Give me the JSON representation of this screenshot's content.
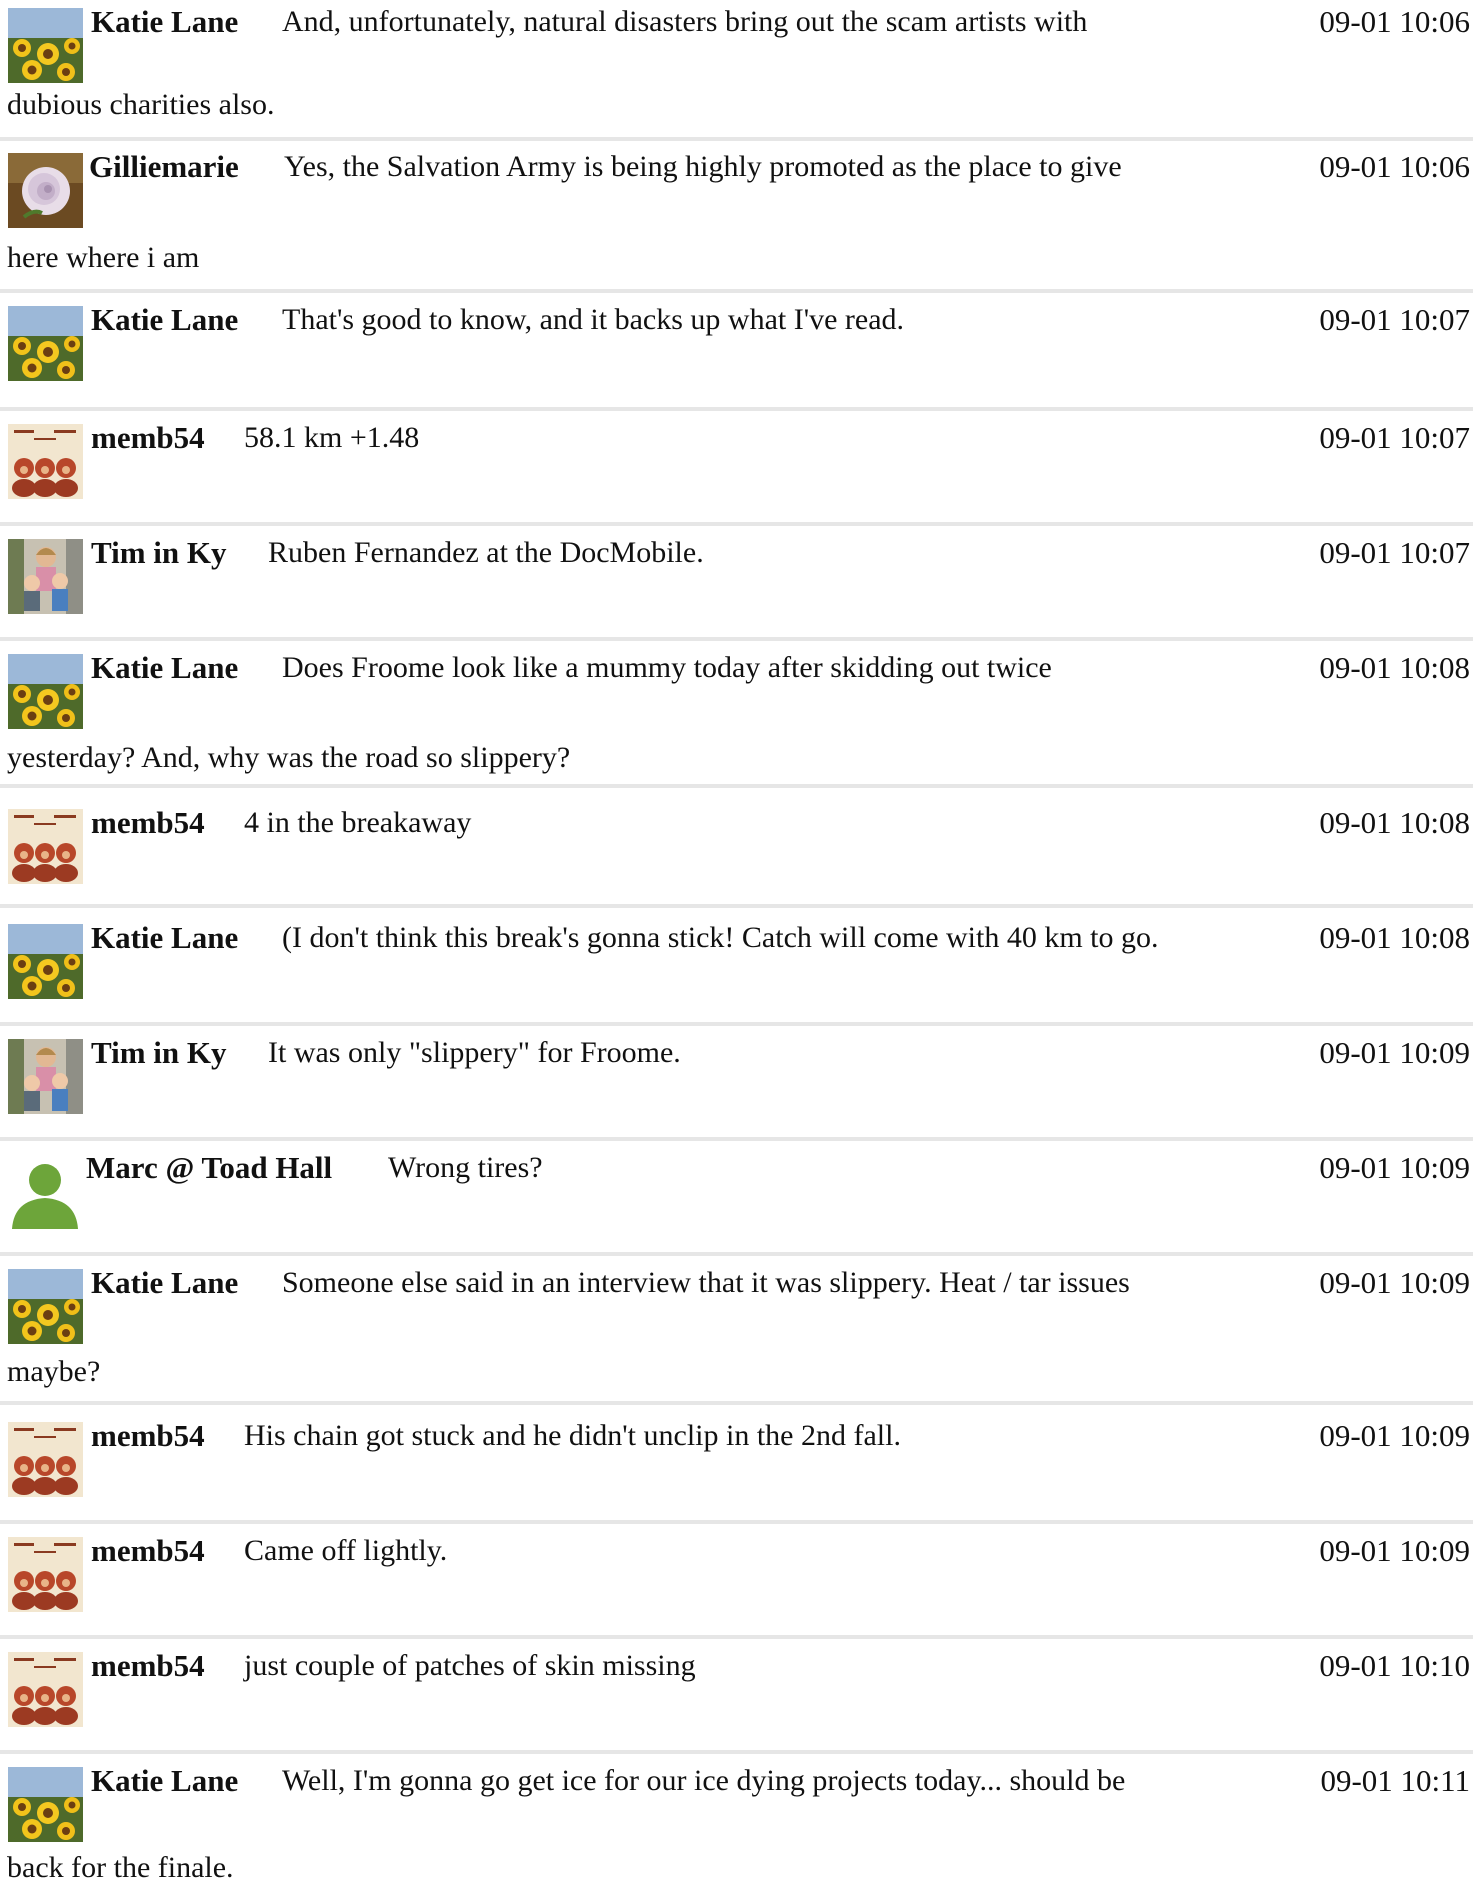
{
  "messages": [
    {
      "user": "Katie Lane",
      "avatar": "sunflower-field-avatar",
      "text": "And, unfortunately, natural disasters bring out the scam artists with",
      "cont": "dubious charities also.",
      "time": "09-01 10:06"
    },
    {
      "user": "Gilliemarie",
      "avatar": "rose-avatar",
      "text": "Yes, the Salvation Army is being highly promoted as the place to give",
      "cont": "here where i am",
      "time": "09-01 10:06"
    },
    {
      "user": "Katie Lane",
      "avatar": "sunflower-field-avatar",
      "text": "That's good to know, and it backs up what I've read.",
      "cont": "",
      "time": "09-01 10:07"
    },
    {
      "user": "memb54",
      "avatar": "three-monkeys-avatar",
      "text": "58.1 km +1.48",
      "cont": "",
      "time": "09-01 10:07"
    },
    {
      "user": "Tim in Ky",
      "avatar": "family-photo-avatar",
      "text": "Ruben Fernandez at the DocMobile.",
      "cont": "",
      "time": "09-01 10:07"
    },
    {
      "user": "Katie Lane",
      "avatar": "sunflower-field-avatar",
      "text": "Does Froome look like a mummy today after skidding out twice",
      "cont": "yesterday? And, why was the road so slippery?",
      "time": "09-01 10:08"
    },
    {
      "user": "memb54",
      "avatar": "three-monkeys-avatar",
      "text": "4 in the breakaway",
      "cont": "",
      "time": "09-01 10:08"
    },
    {
      "user": "Katie Lane",
      "avatar": "sunflower-field-avatar",
      "text": "(I don't think this break's gonna stick! Catch will come with 40 km to go.",
      "cont": "",
      "time": "09-01 10:08"
    },
    {
      "user": "Tim in Ky",
      "avatar": "family-photo-avatar",
      "text": "It was only \"slippery\" for Froome.",
      "cont": "",
      "time": "09-01 10:09"
    },
    {
      "user": "Marc @ Toad Hall",
      "avatar": "default-user-avatar",
      "text": "Wrong tires?",
      "cont": "",
      "time": "09-01 10:09"
    },
    {
      "user": "Katie Lane",
      "avatar": "sunflower-field-avatar",
      "text": "Someone else said in an interview that it was slippery. Heat / tar issues",
      "cont": "maybe?",
      "time": "09-01 10:09"
    },
    {
      "user": "memb54",
      "avatar": "three-monkeys-avatar",
      "text": "His chain got stuck and he didn't unclip in the 2nd fall.",
      "cont": "",
      "time": "09-01 10:09"
    },
    {
      "user": "memb54",
      "avatar": "three-monkeys-avatar",
      "text": "Came off lightly.",
      "cont": "",
      "time": "09-01 10:09"
    },
    {
      "user": "memb54",
      "avatar": "three-monkeys-avatar",
      "text": "just couple of patches of skin missing",
      "cont": "",
      "time": "09-01 10:10"
    },
    {
      "user": "Katie Lane",
      "avatar": "sunflower-field-avatar",
      "text": "Well, I'm gonna go get ice for our ice dying projects today... should be",
      "cont": "back for the finale.",
      "time": "09-01 10:11"
    }
  ]
}
